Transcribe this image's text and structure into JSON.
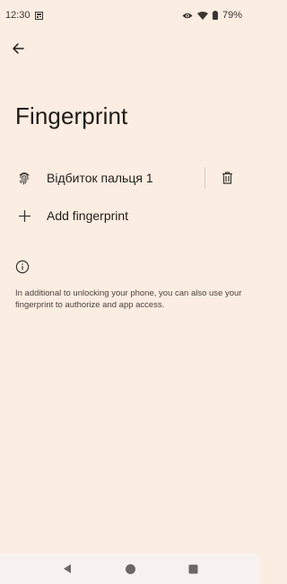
{
  "status": {
    "time": "12:30",
    "battery": "79%"
  },
  "icons": {
    "back": "arrow-back-icon",
    "fingerprint": "fingerprint-icon",
    "delete": "trash-icon",
    "add": "plus-icon",
    "info": "info-icon"
  },
  "page": {
    "title": "Fingerprint"
  },
  "fingerprints": [
    {
      "label": "Відбиток пальця 1"
    }
  ],
  "add_fingerprint": {
    "label": "Add fingerprint"
  },
  "info": {
    "text": "In additional to unlocking your phone, you can also use your fingerprint to authorize and app access."
  },
  "colors": {
    "background": "#fcede2",
    "text": "#1f1b17",
    "nav_background": "#f7f2ef"
  }
}
